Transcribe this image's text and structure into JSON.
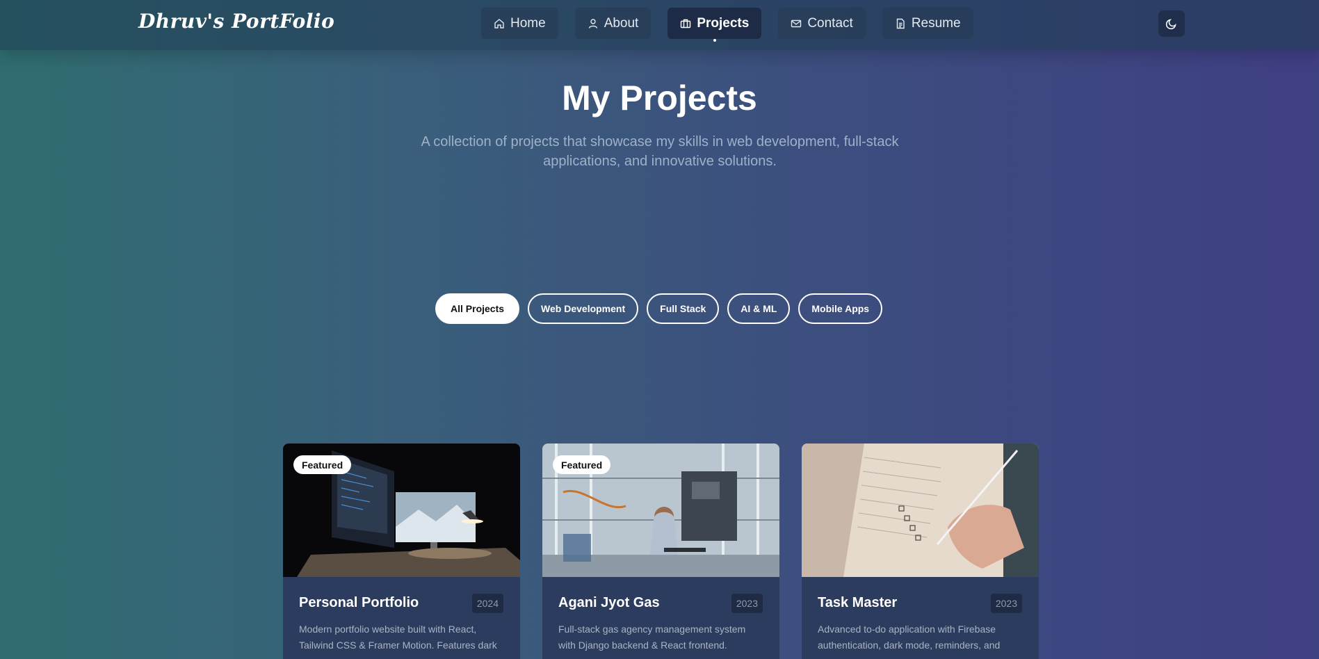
{
  "brand": "Dhruv's PortFolio",
  "nav": [
    {
      "label": "Home",
      "icon": "home-icon"
    },
    {
      "label": "About",
      "icon": "user-icon"
    },
    {
      "label": "Projects",
      "icon": "briefcase-icon",
      "active": true
    },
    {
      "label": "Contact",
      "icon": "mail-icon"
    },
    {
      "label": "Resume",
      "icon": "document-icon"
    }
  ],
  "theme_toggle_icon": "moon-icon",
  "hero": {
    "title": "My Projects",
    "subtitle": "A collection of projects that showcase my skills in web development, full-stack applications, and innovative solutions."
  },
  "filters": [
    "All Projects",
    "Web Development",
    "Full Stack",
    "AI & ML",
    "Mobile Apps"
  ],
  "active_filter": "All Projects",
  "projects": [
    {
      "title": "Personal Portfolio",
      "year": "2024",
      "badge": "Featured",
      "description": "Modern portfolio website built with React, Tailwind CSS & Framer Motion. Features dark"
    },
    {
      "title": "Agani Jyot Gas",
      "year": "2023",
      "badge": "Featured",
      "description": "Full-stack gas agency management system with Django backend & React frontend."
    },
    {
      "title": "Task Master",
      "year": "2023",
      "badge": "",
      "description": "Advanced to-do application with Firebase authentication, dark mode, reminders, and"
    }
  ],
  "colors": {
    "card_bg": "#2c3c5e",
    "nav_active_bg": "#1e2a46",
    "subtitle": "#9fb1c8"
  }
}
